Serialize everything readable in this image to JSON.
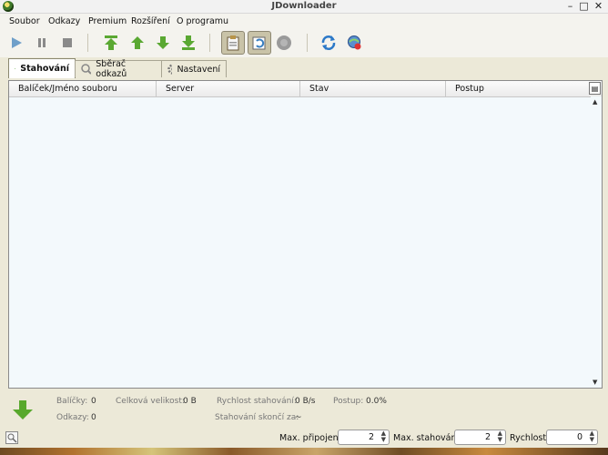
{
  "window": {
    "title": "JDownloader",
    "controls": [
      "–",
      "□",
      "✕"
    ]
  },
  "menu": [
    "Soubor",
    "Odkazy",
    "Premium",
    "Rozšíření",
    "O programu"
  ],
  "toolbar": {
    "icons": [
      "play-icon",
      "pause-icon",
      "stop-icon",
      "move-to-top-icon",
      "move-up-icon",
      "move-down-icon",
      "move-to-bottom-icon",
      "clipboard-watch-icon",
      "auto-reconnect-icon",
      "premium-toggle-icon",
      "reconnect-icon",
      "update-icon"
    ],
    "colors": {
      "play": "#6f9fc9",
      "disabled": "#8a8a8a",
      "arrows": "#5aa832"
    }
  },
  "tabs": [
    {
      "label": "Stahování",
      "icon": "download-arrow-icon",
      "active": true
    },
    {
      "label": "Sběrač odkazů",
      "icon": "link-grabber-icon",
      "active": false
    },
    {
      "label": "Nastavení",
      "icon": "gear-icon",
      "active": false
    }
  ],
  "table": {
    "columns": [
      "Balíček/Jméno souboru",
      "Server",
      "Stav",
      "Postup"
    ],
    "rows": []
  },
  "stats": {
    "packages_label": "Balíčky:",
    "packages": "0",
    "links_label": "Odkazy:",
    "links": "0",
    "total_size_label": "Celková velikost:",
    "total_size": "0 B",
    "speed_label": "Rychlost stahování:",
    "speed": "0 B/s",
    "progress_label": "Postup:",
    "progress": "0.0%",
    "eta_label": "Stahování skončí za:",
    "eta": "~"
  },
  "statusbar": {
    "max_connections_label": "Max. připojení",
    "max_connections": "2",
    "max_downloads_label": "Max. stahování",
    "max_downloads": "2",
    "speed_label": "Rychlost",
    "speed": "0"
  }
}
